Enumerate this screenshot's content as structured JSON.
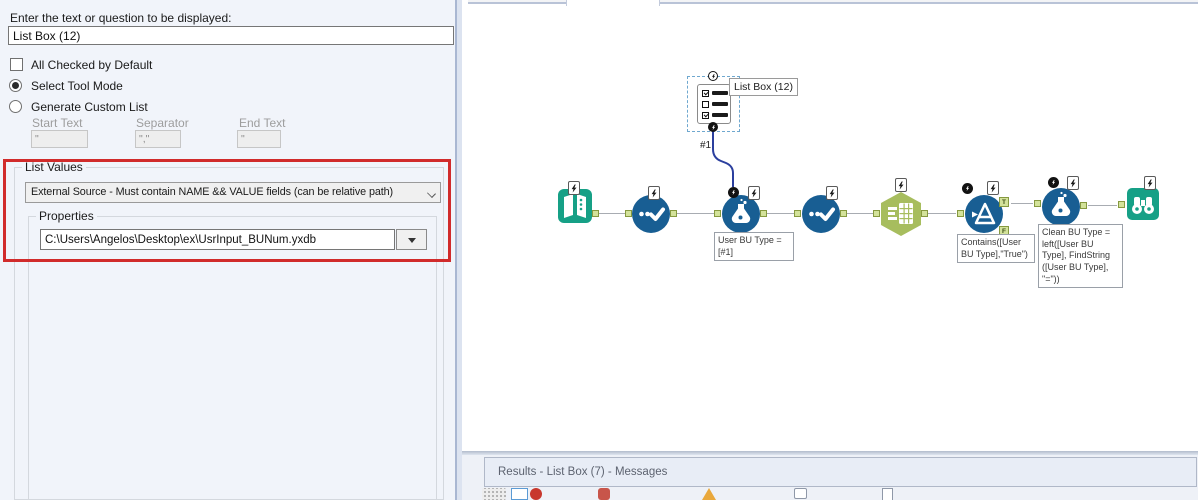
{
  "config_panel": {
    "question_label": "Enter the text or question to be displayed:",
    "question_value": "List Box (12)",
    "all_checked_label": "All Checked by Default",
    "select_tool_mode_label": "Select Tool Mode",
    "generate_custom_list_label": "Generate Custom List",
    "custom_list_fields": {
      "start_text_label": "Start Text",
      "start_text_value": "\"",
      "separator_label": "Separator",
      "separator_value": "\",\"",
      "end_text_label": "End Text",
      "end_text_value": "\""
    },
    "list_values": {
      "group_label": "List Values",
      "source_mode_value": "External Source - Must contain NAME && VALUE fields  (can be relative path)",
      "properties_group_label": "Properties",
      "external_path_value": "C:\\Users\\Angelos\\Desktop\\ex\\UsrInput_BUNum.yxdb"
    }
  },
  "canvas": {
    "listbox_tool": {
      "label": "List Box (12)"
    },
    "question_wire_label": "#1",
    "tools": [
      "input-data",
      "select",
      "formula",
      "select",
      "summarize",
      "filter",
      "formula",
      "browse"
    ],
    "annotations": {
      "formula1": "User BU Type = [#1]",
      "filter": "Contains([User BU Type],\"True\")",
      "formula2": "Clean BU Type = left([User BU Type], FindString ([User BU Type], \"=\"))"
    },
    "filter_outputs": {
      "true_label": "T",
      "false_label": "F"
    }
  },
  "results_panel": {
    "header": "Results - List Box (7) - Messages",
    "toolbar_icons": [
      "grip",
      "canvas-overview-icon",
      "error-icon",
      "conversion-error-icon",
      "warning-icon",
      "message-icon",
      "file-icon"
    ]
  },
  "colors": {
    "tool_blue": "#185e93",
    "tool_teal": "#16a086",
    "tool_olive": "#a7bd5e",
    "anchor_green": "#d3e29a",
    "highlight_red": "#d12b2b",
    "question_wire_blue": "#2b3f9e"
  }
}
